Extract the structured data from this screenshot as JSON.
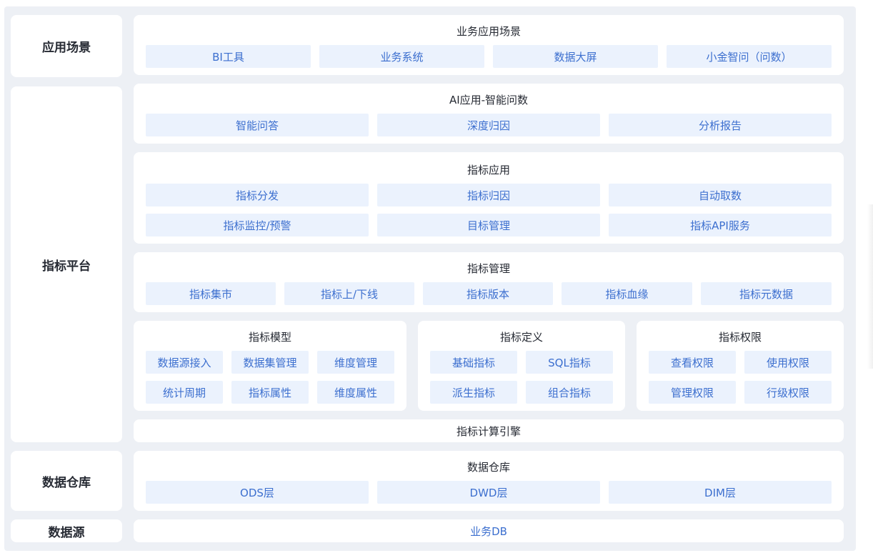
{
  "left_labels": {
    "scenario": "应用场景",
    "platform": "指标平台",
    "warehouse": "数据仓库",
    "source": "数据源"
  },
  "business": {
    "title": "业务应用场景",
    "items": [
      "BI工具",
      "业务系统",
      "数据大屏",
      "小金智问（问数）"
    ]
  },
  "ai": {
    "title": "AI应用-智能问数",
    "items": [
      "智能问答",
      "深度归因",
      "分析报告"
    ]
  },
  "metric_app": {
    "title": "指标应用",
    "items": [
      "指标分发",
      "指标归因",
      "自动取数",
      "指标监控/预警",
      "目标管理",
      "指标API服务"
    ]
  },
  "metric_mgmt": {
    "title": "指标管理",
    "items": [
      "指标集市",
      "指标上/下线",
      "指标版本",
      "指标血缘",
      "指标元数据"
    ]
  },
  "metric_model": {
    "title": "指标模型",
    "items": [
      "数据源接入",
      "数据集管理",
      "维度管理",
      "统计周期",
      "指标属性",
      "维度属性"
    ]
  },
  "metric_def": {
    "title": "指标定义",
    "items": [
      "基础指标",
      "SQL指标",
      "派生指标",
      "组合指标"
    ]
  },
  "metric_perm": {
    "title": "指标权限",
    "items": [
      "查看权限",
      "使用权限",
      "管理权限",
      "行级权限"
    ]
  },
  "engine": {
    "label": "指标计算引擎"
  },
  "warehouse": {
    "title": "数据仓库",
    "items": [
      "ODS层",
      "DWD层",
      "DIM层"
    ]
  },
  "source": {
    "label": "业务DB"
  },
  "colors": {
    "frame": "#edf0f5",
    "card": "#ffffff",
    "chip_bg": "#ebf2fd",
    "chip_text": "#3c6fcf",
    "title_text": "#262a33"
  }
}
